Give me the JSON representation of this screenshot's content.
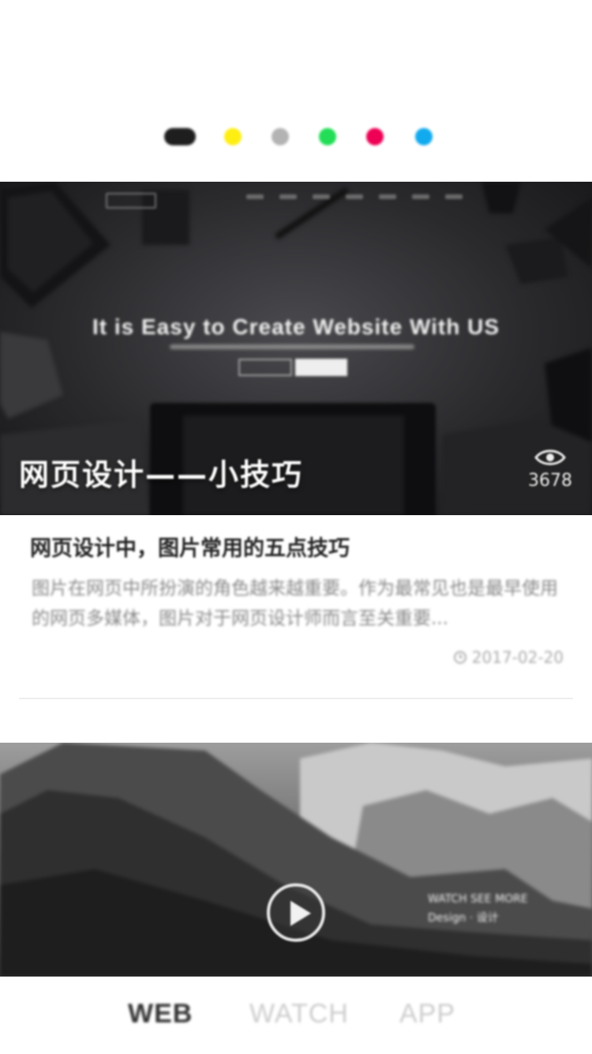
{
  "color_picker": {
    "dots": [
      {
        "name": "black",
        "color": "#1e1e1e",
        "active": true
      },
      {
        "name": "yellow",
        "color": "#ffee11",
        "active": false
      },
      {
        "name": "gray",
        "color": "#b3b3b3",
        "active": false
      },
      {
        "name": "green",
        "color": "#22dd55",
        "active": false
      },
      {
        "name": "red",
        "color": "#ee0055",
        "active": false
      },
      {
        "name": "blue",
        "color": "#11aaee",
        "active": false
      }
    ]
  },
  "card1": {
    "hero_headline": "It is Easy to Create Website With US",
    "caption": "网页设计——小技巧",
    "views": "3678",
    "title": "网页设计中，图片常用的五点技巧",
    "summary": "图片在网页中所扮演的角色越来越重要。作为最常见也是最早使用的网页多媒体，图片对于网页设计师而言至关重要...",
    "date": "2017-02-20"
  },
  "card2": {
    "overlay_line1": "WATCH  SEE  MORE",
    "overlay_line2": "Design  · 设计"
  },
  "tabs": [
    {
      "label": "WEB",
      "active": true
    },
    {
      "label": "WATCH",
      "active": false
    },
    {
      "label": "APP",
      "active": false
    }
  ]
}
